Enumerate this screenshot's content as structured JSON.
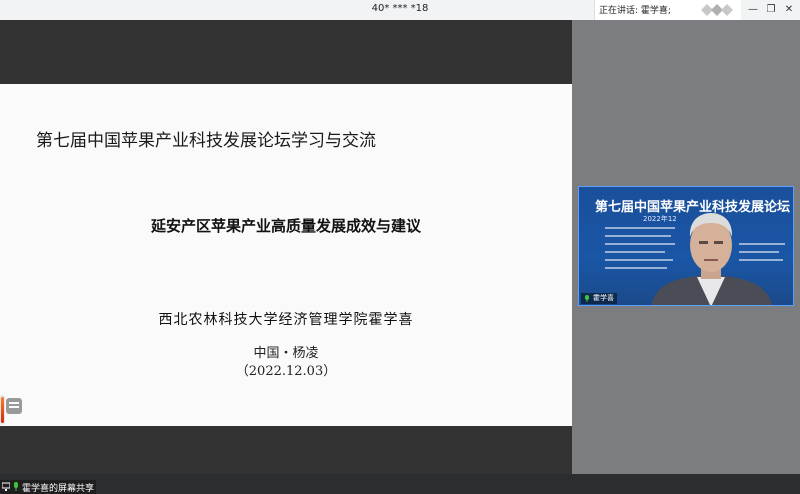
{
  "titlebar": {
    "meeting_id": "40* *** *18",
    "speaking": "正在讲话: 霍学喜;",
    "minimize": "—",
    "restore": "❐",
    "close": "✕"
  },
  "slide": {
    "title": "第七届中国苹果产业科技发展论坛学习与交流",
    "subtitle": "延安产区苹果产业高质量发展成效与建议",
    "author": "西北农林科技大学经济管理学院霍学喜",
    "place": "中国・杨凌",
    "date": "（2022.12.03）"
  },
  "status": {
    "share_label": "霍学喜的屏幕共享"
  },
  "video": {
    "banner_title": "第七届中国苹果产业科技发展论坛",
    "banner_date": "2022年12",
    "name": "霍学喜"
  },
  "colors": {
    "mic_green": "#3ec43e",
    "video_blue": "#1a56a6"
  }
}
